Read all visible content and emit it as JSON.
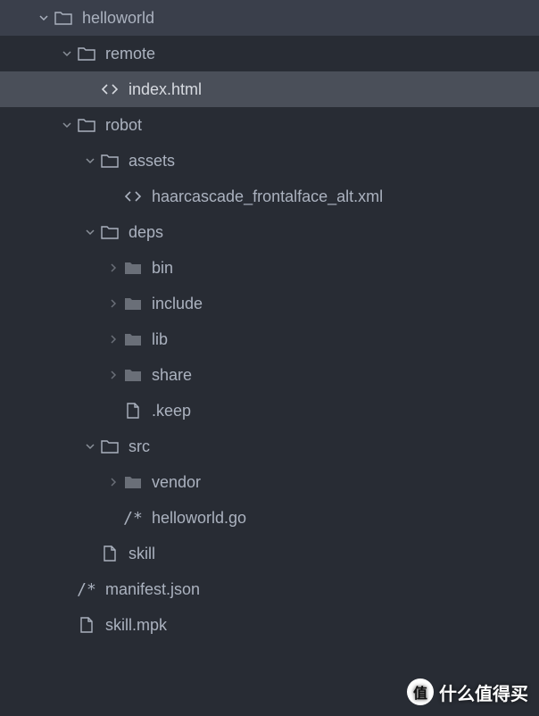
{
  "tree": {
    "root": {
      "label": "helloworld",
      "type": "folder",
      "expanded": true
    },
    "remote": {
      "label": "remote",
      "type": "folder",
      "expanded": true
    },
    "index_html": {
      "label": "index.html",
      "type": "code"
    },
    "robot": {
      "label": "robot",
      "type": "folder",
      "expanded": true
    },
    "assets": {
      "label": "assets",
      "type": "folder",
      "expanded": true
    },
    "haarcascade": {
      "label": "haarcascade_frontalface_alt.xml",
      "type": "code"
    },
    "deps": {
      "label": "deps",
      "type": "folder",
      "expanded": true
    },
    "bin": {
      "label": "bin",
      "type": "folder",
      "expanded": false
    },
    "include": {
      "label": "include",
      "type": "folder",
      "expanded": false
    },
    "lib": {
      "label": "lib",
      "type": "folder",
      "expanded": false
    },
    "share": {
      "label": "share",
      "type": "folder",
      "expanded": false
    },
    "keep": {
      "label": ".keep",
      "type": "file"
    },
    "src": {
      "label": "src",
      "type": "folder",
      "expanded": true
    },
    "vendor": {
      "label": "vendor",
      "type": "folder",
      "expanded": false
    },
    "helloworld_go": {
      "label": "helloworld.go",
      "type": "source"
    },
    "skill": {
      "label": "skill",
      "type": "file"
    },
    "manifest_json": {
      "label": "manifest.json",
      "type": "source"
    },
    "skill_mpk": {
      "label": "skill.mpk",
      "type": "file"
    }
  },
  "watermark": {
    "badge": "值",
    "text": "什么值得买"
  }
}
